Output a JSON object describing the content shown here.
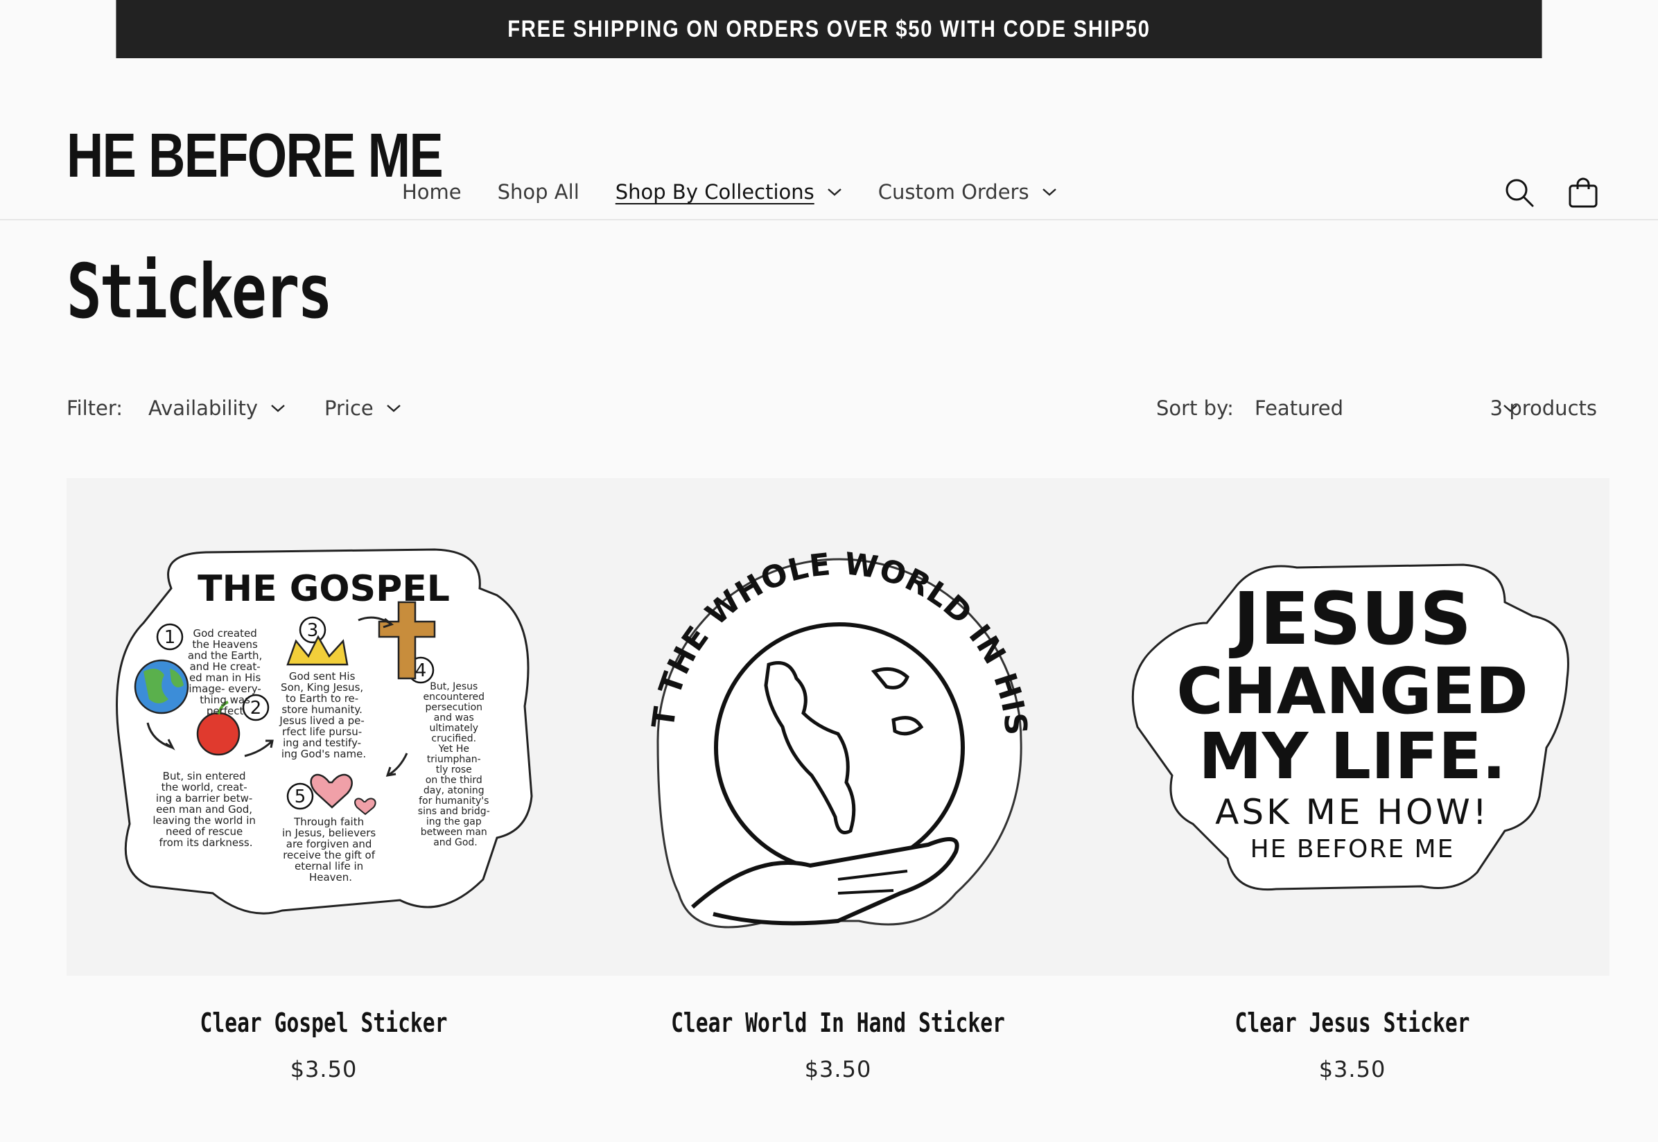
{
  "announcement": "FREE SHIPPING ON ORDERS OVER $50 WITH CODE SHIP50",
  "header": {
    "logo": "HE BEFORE ME",
    "nav": [
      {
        "label": "Home"
      },
      {
        "label": "Shop All"
      },
      {
        "label": "Shop By Collections"
      },
      {
        "label": "Custom Orders"
      }
    ]
  },
  "page": {
    "title": "Stickers"
  },
  "filters": {
    "label": "Filter:",
    "availability": "Availability",
    "price": "Price",
    "sort_label": "Sort by:",
    "sort_value": "Featured",
    "count": "3 products"
  },
  "products": [
    {
      "title": "Clear Gospel Sticker",
      "price": "$3.50"
    },
    {
      "title": "Clear World In Hand Sticker",
      "price": "$3.50"
    },
    {
      "title": "Clear Jesus Sticker",
      "price": "$3.50"
    }
  ],
  "sticker_art": {
    "gospel": {
      "heading": "THE GOSPEL",
      "step1": [
        "God created",
        "the Heavens",
        "and the Earth,",
        "and He creat-",
        "ed man in His",
        "image- every-",
        "thing was",
        "perfect."
      ],
      "step2": [
        "But, sin entered",
        "the world, creat-",
        "ing a barrier betw-",
        "een man and God,",
        "leaving the world in",
        "need of rescue",
        "from its darkness."
      ],
      "step3": [
        "God sent His",
        "Son, King Jesus,",
        "to Earth to re-",
        "store humanity.",
        "Jesus lived a pe-",
        "rfect life pursu-",
        "ing and testify-",
        "ing God's name."
      ],
      "step4": [
        "But, Jesus",
        "encountered",
        "persecution",
        "and was",
        "ultimately",
        "crucified.",
        "Yet He",
        "triumphan-",
        "tly rose",
        "on the third",
        "day, atoning",
        "for humanity's",
        "sins and bridg-",
        "ing the gap",
        "between man",
        "and God."
      ],
      "step5": [
        "Through faith",
        "in Jesus, believers",
        "are forgiven and",
        "receive the gift of",
        "eternal life in",
        "Heaven."
      ]
    },
    "world": {
      "arc_text": "HE'S GOT THE WHOLE WORLD IN HIS HANDS"
    },
    "jesus": {
      "line1": "JESUS",
      "line2": "CHANGED",
      "line3": "MY LIFE.",
      "line4": "ASK ME HOW!",
      "line5": "HE BEFORE ME"
    }
  }
}
